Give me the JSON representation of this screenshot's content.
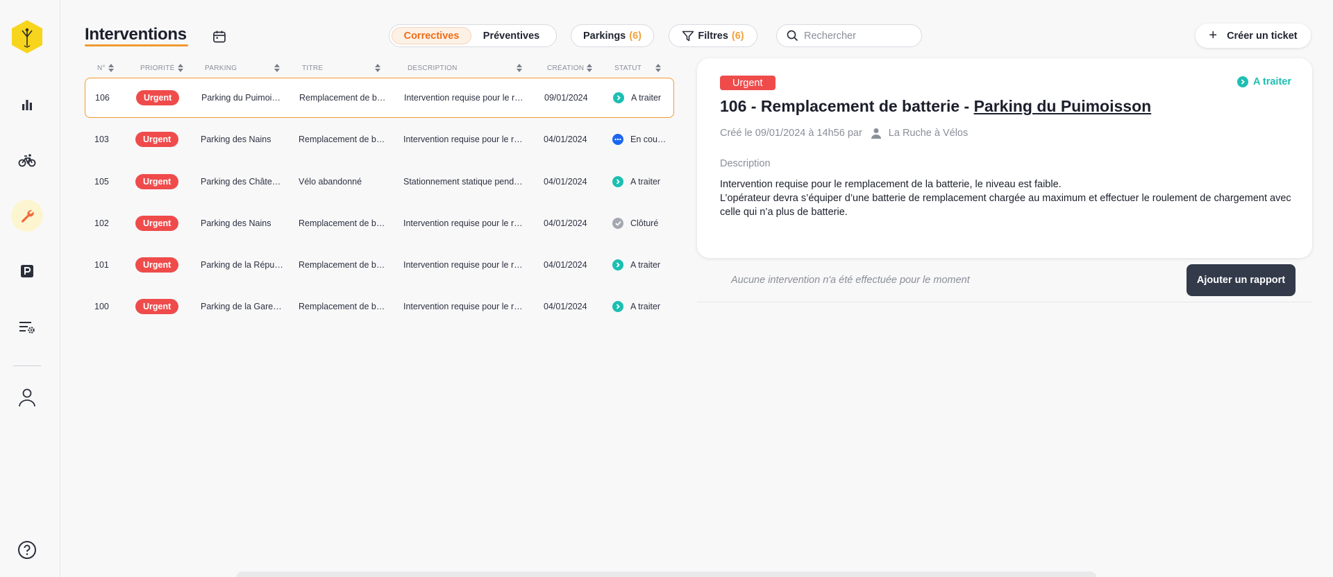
{
  "header": {
    "title": "Interventions",
    "segment": {
      "active": "Correctives",
      "inactive": "Préventives"
    },
    "parkings": {
      "label": "Parkings",
      "count": "(6)"
    },
    "filters": {
      "label": "Filtres",
      "count": "(6)"
    },
    "search": {
      "placeholder": "Rechercher"
    },
    "create": {
      "label": "Créer un ticket"
    }
  },
  "table": {
    "headers": [
      "N°",
      "PRIORITÉ",
      "PARKING",
      "TITRE",
      "DESCRIPTION",
      "CRÉATION",
      "STATUT"
    ],
    "rows": [
      {
        "num": "106",
        "priority": "Urgent",
        "parking": "Parking du Puimoi…",
        "title": "Remplacement de b…",
        "description": "Intervention requise pour le r…",
        "created": "09/01/2024",
        "status": "A traiter",
        "status_icon": "chevron-right-icon",
        "status_color": "#1cbfb1"
      },
      {
        "num": "103",
        "priority": "Urgent",
        "parking": "Parking des Nains",
        "title": "Remplacement de b…",
        "description": "Intervention requise pour le r…",
        "created": "04/01/2024",
        "status": "En cou…",
        "status_icon": "ellipsis-icon",
        "status_color": "#1b66f2"
      },
      {
        "num": "105",
        "priority": "Urgent",
        "parking": "Parking des Châte…",
        "title": "Vélo abandonné",
        "description": "Stationnement statique pend…",
        "created": "04/01/2024",
        "status": "A traiter",
        "status_icon": "chevron-right-icon",
        "status_color": "#1cbfb1"
      },
      {
        "num": "102",
        "priority": "Urgent",
        "parking": "Parking des Nains",
        "title": "Remplacement de b…",
        "description": "Intervention requise pour le r…",
        "created": "04/01/2024",
        "status": "Clôturé",
        "status_icon": "check-icon",
        "status_color": "#a5a8b1"
      },
      {
        "num": "101",
        "priority": "Urgent",
        "parking": "Parking de la Répu…",
        "title": "Remplacement de b…",
        "description": "Intervention requise pour le r…",
        "created": "04/01/2024",
        "status": "A traiter",
        "status_icon": "chevron-right-icon",
        "status_color": "#1cbfb1"
      },
      {
        "num": "100",
        "priority": "Urgent",
        "parking": "Parking de la Gare…",
        "title": "Remplacement de b…",
        "description": "Intervention requise pour le r…",
        "created": "04/01/2024",
        "status": "A traiter",
        "status_icon": "chevron-right-icon",
        "status_color": "#1cbfb1"
      }
    ]
  },
  "detail": {
    "priority": "Urgent",
    "status": "A traiter",
    "title_prefix": "106 - Remplacement de batterie - ",
    "title_link": "Parking du Puimoisson",
    "created": "Créé le 09/01/2024 à 14h56 par",
    "author": "La Ruche à Vélos",
    "description_label": "Description",
    "description_line1": "Intervention requise pour le remplacement de la batterie, le niveau est faible.",
    "description_line2": "L’opérateur devra s’équiper d’une batterie de remplacement chargée au maximum et effectuer le roulement de chargement avec celle qui n’a plus de batterie."
  },
  "report": {
    "empty_text": "Aucune intervention n'a été effectuée pour le moment",
    "button": "Ajouter un rapport"
  },
  "sidebar": {
    "items": [
      "logo-icon",
      "stats-icon",
      "bike-icon",
      "wrench-icon",
      "parking-icon",
      "settings-list-icon",
      "user-icon",
      "help-icon"
    ],
    "active": "wrench-icon"
  },
  "colors": {
    "accent": "#f2992e",
    "urgent": "#ef4b4b",
    "teal": "#1cbfb1",
    "blue": "#1b66f2",
    "dark": "#333a4a"
  }
}
